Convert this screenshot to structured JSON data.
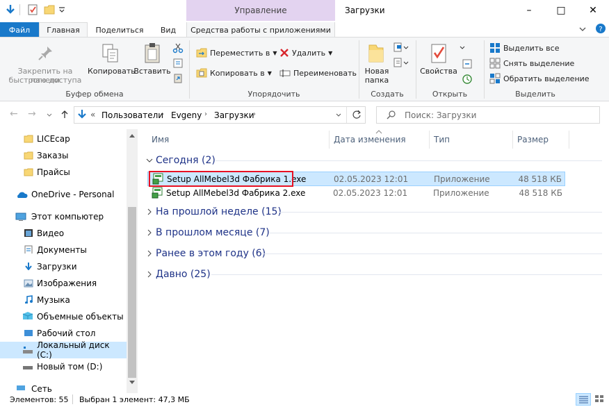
{
  "window": {
    "title": "Загрузки",
    "context_tab_header": "Управление",
    "minimize_glyph": "–",
    "maximize_glyph": "□",
    "close_glyph": "✕"
  },
  "tabs": {
    "file": "Файл",
    "home": "Главная",
    "share": "Поделиться",
    "view": "Вид",
    "app_tools": "Средства работы с приложениями"
  },
  "ribbon": {
    "clipboard": {
      "pin_label_1": "Закрепить на панели",
      "pin_label_2": "быстрого доступа",
      "copy": "Копировать",
      "paste": "Вставить",
      "group": "Буфер обмена"
    },
    "organize": {
      "move_to": "Переместить в",
      "copy_to": "Копировать в",
      "delete": "Удалить",
      "rename": "Переименовать",
      "group": "Упорядочить"
    },
    "new": {
      "folder_1": "Новая",
      "folder_2": "папка",
      "group": "Создать"
    },
    "open": {
      "properties": "Свойства",
      "group": "Открыть"
    },
    "select": {
      "select_all": "Выделить все",
      "select_none": "Снять выделение",
      "invert": "Обратить выделение",
      "group": "Выделить"
    }
  },
  "address": {
    "overflow": "«",
    "crumbs": [
      "Пользователи",
      "Evgeny",
      "Загрузки"
    ],
    "search_placeholder": "Поиск: Загрузки"
  },
  "nav": {
    "items": [
      {
        "label": "LICEcap",
        "icon": "folder-icon"
      },
      {
        "label": "Заказы",
        "icon": "folder-icon"
      },
      {
        "label": "Прайсы",
        "icon": "folder-icon"
      },
      {
        "label": "OneDrive - Personal",
        "icon": "cloud-icon"
      },
      {
        "label": "Этот компьютер",
        "icon": "computer-icon"
      },
      {
        "label": "Видео",
        "icon": "video-icon"
      },
      {
        "label": "Документы",
        "icon": "documents-icon"
      },
      {
        "label": "Загрузки",
        "icon": "download-icon"
      },
      {
        "label": "Изображения",
        "icon": "pictures-icon"
      },
      {
        "label": "Музыка",
        "icon": "music-icon"
      },
      {
        "label": "Объемные объекты",
        "icon": "3d-objects-icon"
      },
      {
        "label": "Рабочий стол",
        "icon": "desktop-icon"
      },
      {
        "label": "Локальный диск (C:)",
        "icon": "drive-icon"
      },
      {
        "label": "Новый том (D:)",
        "icon": "drive-icon"
      },
      {
        "label": "Сеть",
        "icon": "network-icon"
      }
    ]
  },
  "columns": {
    "name": "Имя",
    "date": "Дата изменения",
    "type": "Тип",
    "size": "Размер"
  },
  "groups": [
    {
      "label": "Сегодня (2)",
      "expanded": true
    },
    {
      "label": "На прошлой неделе (15)",
      "expanded": false
    },
    {
      "label": "В прошлом месяце (7)",
      "expanded": false
    },
    {
      "label": "Ранее в этом году (6)",
      "expanded": false
    },
    {
      "label": "Давно (25)",
      "expanded": false
    }
  ],
  "files": [
    {
      "name": "Setup AllMebel3d Фабрика 1.exe",
      "date": "02.05.2023 12:01",
      "type": "Приложение",
      "size": "48 518 КБ",
      "selected": true
    },
    {
      "name": "Setup AllMebel3d Фабрика 2.exe",
      "date": "02.05.2023 12:01",
      "type": "Приложение",
      "size": "48 518 КБ",
      "selected": false
    }
  ],
  "status": {
    "items": "Элементов: 55",
    "selection": "Выбран 1 элемент: 47,3 МБ"
  },
  "colors": {
    "accent": "#1979ca",
    "selection": "#cce8ff",
    "highlight_box": "#e81123",
    "group_header": "#1e3287",
    "context_band": "#e3d3f0"
  }
}
